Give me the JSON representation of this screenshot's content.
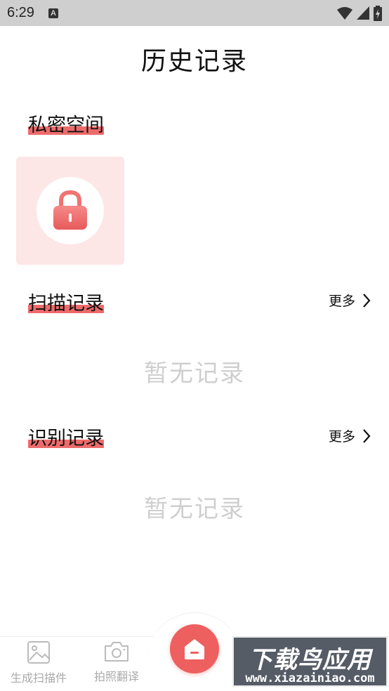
{
  "status_bar": {
    "time": "6:29",
    "notification_badge": "A"
  },
  "page": {
    "title": "历史记录"
  },
  "private_space": {
    "heading": "私密空间",
    "icon": "lock-icon"
  },
  "scan_records": {
    "heading": "扫描记录",
    "more_label": "更多",
    "empty_text": "暂无记录"
  },
  "recognition_records": {
    "heading": "识别记录",
    "more_label": "更多",
    "empty_text": "暂无记录"
  },
  "bottom_nav": {
    "items": [
      {
        "label": "生成扫描件",
        "icon": "image-icon"
      },
      {
        "label": "拍照翻译",
        "icon": "camera-icon"
      }
    ],
    "center_icon": "home-icon"
  },
  "watermark": {
    "title": "下载鸟应用",
    "url": "www.xiazainiao.com"
  },
  "colors": {
    "accent": "#ee5f5f",
    "card_bg": "#fde6e6",
    "muted_text": "#cfcfcf"
  }
}
